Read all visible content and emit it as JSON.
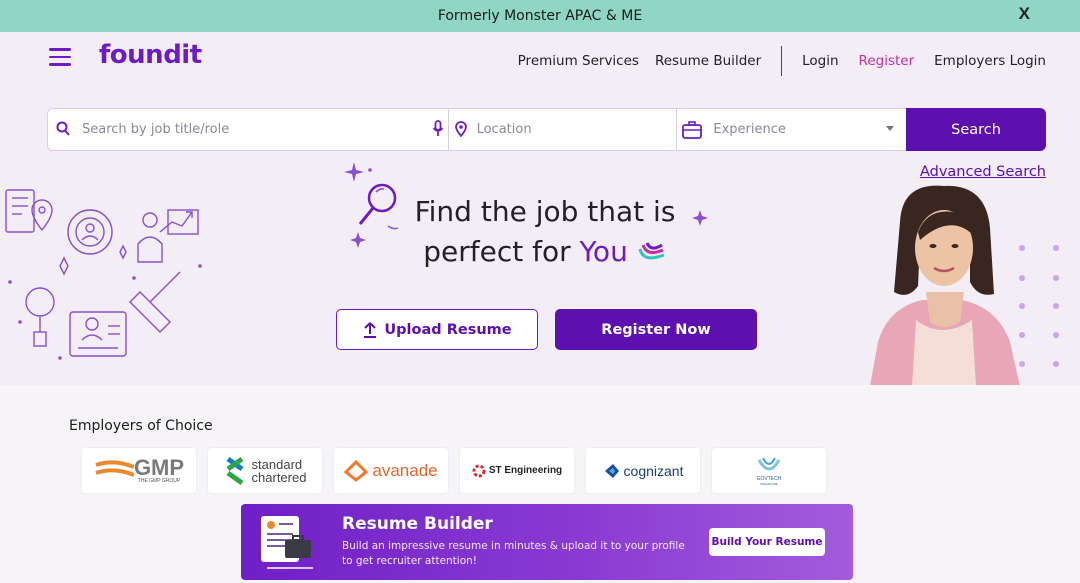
{
  "banner": {
    "text": "Formerly Monster APAC & ME",
    "close_label": "X"
  },
  "header": {
    "logo": "foundit",
    "nav": {
      "premium": "Premium Services",
      "resume_builder": "Resume Builder",
      "login": "Login",
      "register": "Register",
      "employers_login": "Employers Login"
    }
  },
  "search": {
    "job_placeholder": "Search by job title/role",
    "location_placeholder": "Location",
    "experience_placeholder": "Experience",
    "button": "Search",
    "advanced": "Advanced Search"
  },
  "hero": {
    "headline_line1": "Find the job that is",
    "headline_line2_prefix": "perfect for",
    "headline_highlight": "You",
    "upload_button": "Upload Resume",
    "register_button": "Register Now"
  },
  "employers": {
    "title": "Employers of Choice",
    "logos": [
      {
        "name": "GMP",
        "sub": "THE GMP GROUP"
      },
      {
        "name": "standard",
        "sub": "chartered"
      },
      {
        "name": "avanade"
      },
      {
        "name": "ST Engineering"
      },
      {
        "name": "cognizant"
      },
      {
        "name": "GOVTECH",
        "sub": "SINGAPORE"
      }
    ]
  },
  "resume_builder": {
    "title": "Resume Builder",
    "description": "Build an impressive resume in minutes & upload it to your profile to get recruiter attention!",
    "button": "Build Your Resume"
  },
  "colors": {
    "brand": "#6e1bc4",
    "brand_dark": "#5d0fb0",
    "banner": "#8fd6c4",
    "hero_bg": "#f3edf6",
    "register_link": "#c62fa5"
  }
}
